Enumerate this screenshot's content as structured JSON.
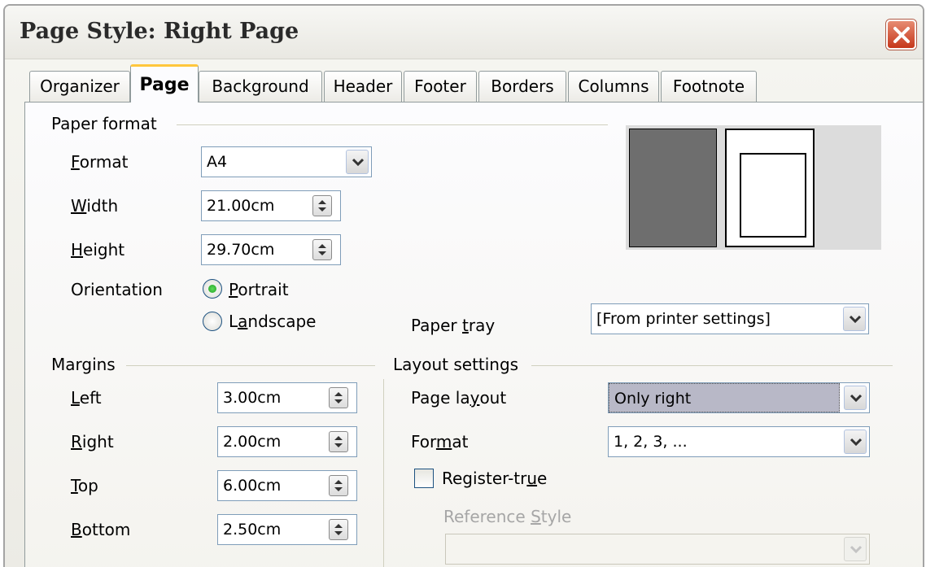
{
  "window": {
    "title": "Page Style: Right Page"
  },
  "tabs": [
    {
      "label": "Organizer"
    },
    {
      "label": "Page"
    },
    {
      "label": "Background"
    },
    {
      "label": "Header"
    },
    {
      "label": "Footer"
    },
    {
      "label": "Borders"
    },
    {
      "label": "Columns"
    },
    {
      "label": "Footnote"
    }
  ],
  "active_tab": "Page",
  "paper_format": {
    "group_label": "Paper format",
    "format": {
      "label_first": "F",
      "label_rest": "ormat",
      "value": "A4"
    },
    "width": {
      "label_first": "W",
      "label_rest": "idth",
      "value": "21.00cm"
    },
    "height": {
      "label_first": "H",
      "label_rest": "eight",
      "value": "29.70cm"
    },
    "orientation": {
      "label": "Orientation",
      "portrait": {
        "first": "P",
        "rest": "ortrait",
        "selected": true
      },
      "landscape": {
        "pre": "L",
        "u": "a",
        "rest": "ndscape",
        "selected": false
      }
    },
    "paper_tray": {
      "pre": "Paper ",
      "u": "t",
      "rest": "ray",
      "value": "[From printer settings]"
    }
  },
  "margins": {
    "group_label": "Margins",
    "left": {
      "first": "L",
      "rest": "eft",
      "value": "3.00cm"
    },
    "right": {
      "first": "R",
      "rest": "ight",
      "value": "2.00cm"
    },
    "top": {
      "first": "T",
      "rest": "op",
      "value": "6.00cm"
    },
    "bottom": {
      "first": "B",
      "rest": "ottom",
      "value": "2.50cm"
    }
  },
  "layout_settings": {
    "group_label": "Layout settings",
    "page_layout": {
      "pre": "Page la",
      "u": "y",
      "rest": "out",
      "value": "Only right"
    },
    "format": {
      "pre": "For",
      "u": "m",
      "rest": "at",
      "value": "1, 2, 3, ..."
    },
    "register_true": {
      "pre": "Register-tr",
      "u": "u",
      "rest": "e",
      "checked": false
    },
    "reference_style": {
      "pre": "Reference ",
      "u": "S",
      "rest": "tyle",
      "value": ""
    }
  },
  "colors": {
    "accent_tab": "#ffc73c",
    "close_button": "#c6371b",
    "preview_page": "#6e6e6e"
  }
}
